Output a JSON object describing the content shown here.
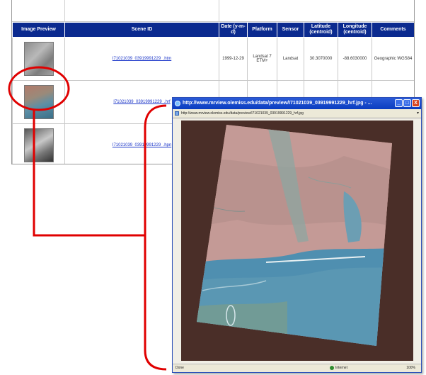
{
  "table": {
    "headers": [
      "Image Preview",
      "Scene ID",
      "Date (y-m-d)",
      "Platform",
      "Sensor",
      "Latitude (centroid)",
      "Longitude (centroid)",
      "Comments"
    ],
    "rows": [
      {
        "scene_id": "I71021039_03919991229_.htm",
        "date": "1999-12-29",
        "platform": "Landsat 7 ETM+",
        "sensor": "Landsat",
        "latitude": "30.3070000",
        "longitude": "-88.6030000",
        "comments": "Geographic WGS84"
      },
      {
        "scene_id": "I71021039_03919991229_.hrf",
        "date": "",
        "platform": "",
        "sensor": "",
        "latitude": "",
        "longitude": "",
        "comments": ""
      },
      {
        "scene_id": "I71021039_03919991229_.hpn",
        "date": "",
        "platform": "",
        "sensor": "",
        "latitude": "",
        "longitude": "",
        "comments": ""
      }
    ]
  },
  "popup": {
    "title": "http://www.mrview.olemiss.edu/data/preview/I71021039_03919991229_hrf.jpg - ...",
    "address": "http://www.mrview.olemiss.edu/data/preview/I71021039_03919991229_hrf.jpg",
    "buttons": {
      "minimize": "_",
      "maximize": "□",
      "close": "X"
    },
    "status": {
      "done": "Done",
      "zone": "Internet",
      "zoom": "100%"
    }
  },
  "colors": {
    "header_bg": "#0b2a8f",
    "link": "#1a35c8",
    "callout": "#e00000",
    "titlebar": "#0a3cc0",
    "viewport_bg": "#4a2e28"
  }
}
